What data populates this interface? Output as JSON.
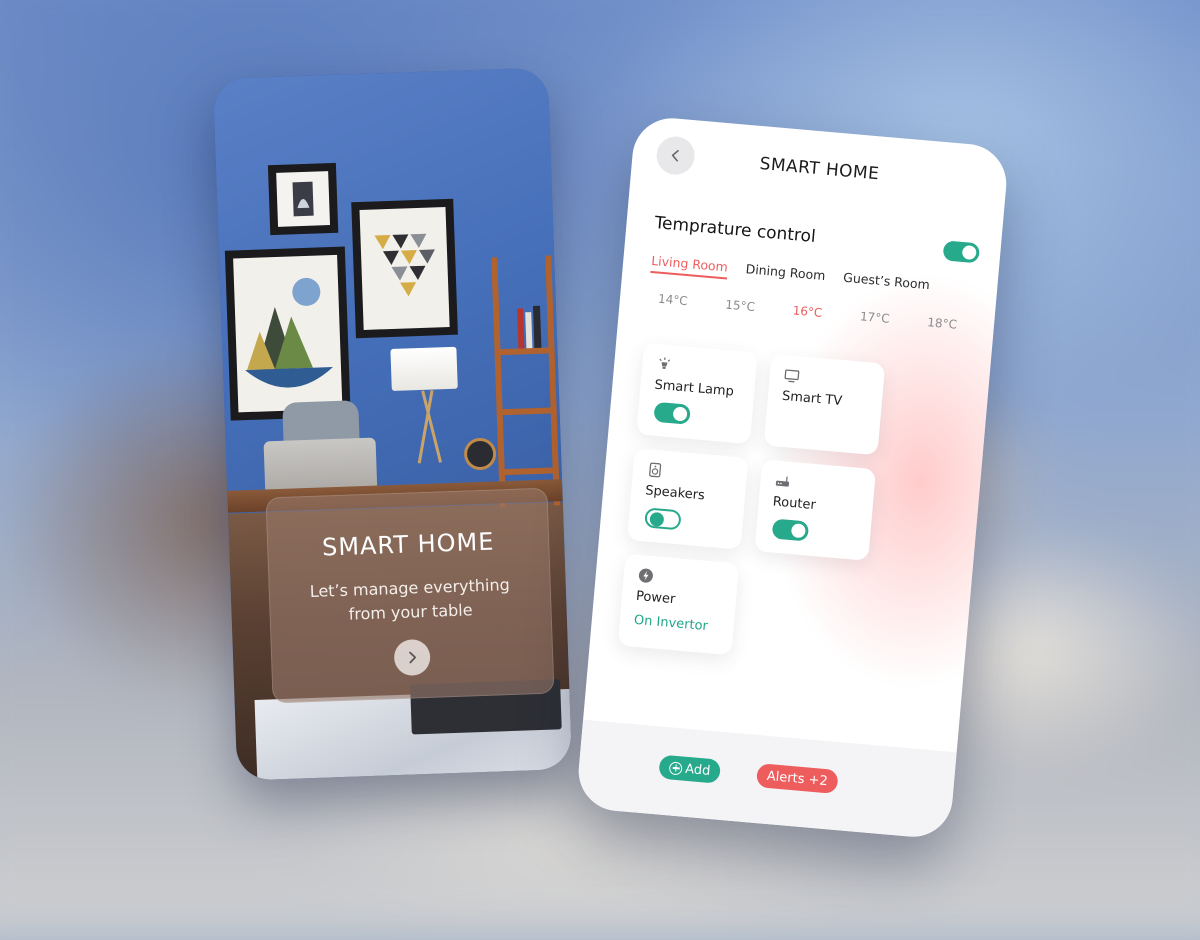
{
  "welcome": {
    "title": "SMART HOME",
    "subtitle_line1": "Let’s manage everything",
    "subtitle_line2": "from your table",
    "next_icon": "chevron-right-icon"
  },
  "app": {
    "title": "SMART HOME",
    "back_icon": "chevron-left-icon"
  },
  "temperature": {
    "title": "Temprature control",
    "enabled": true,
    "rooms": [
      "Living Room",
      "Dining Room",
      "Guest’s Room"
    ],
    "active_room": "Living Room",
    "values": [
      "14°C",
      "15°C",
      "16°C",
      "17°C",
      "18°C"
    ],
    "active_value": "16°C"
  },
  "devices": [
    {
      "label": "Smart Lamp",
      "icon": "lamp-icon",
      "toggle": "on"
    },
    {
      "label": "Smart TV",
      "icon": "tv-icon"
    },
    {
      "label": "Speakers",
      "icon": "speaker-icon",
      "toggle": "off"
    },
    {
      "label": "Router",
      "icon": "router-icon",
      "toggle": "on"
    },
    {
      "label": "Power",
      "icon": "lightning-icon",
      "status": "On Invertor"
    }
  ],
  "bottom": {
    "add_label": "Add",
    "alerts_label": "Alerts +2"
  },
  "colors": {
    "accent_green": "#27a98c",
    "accent_red": "#ee5d5d"
  }
}
